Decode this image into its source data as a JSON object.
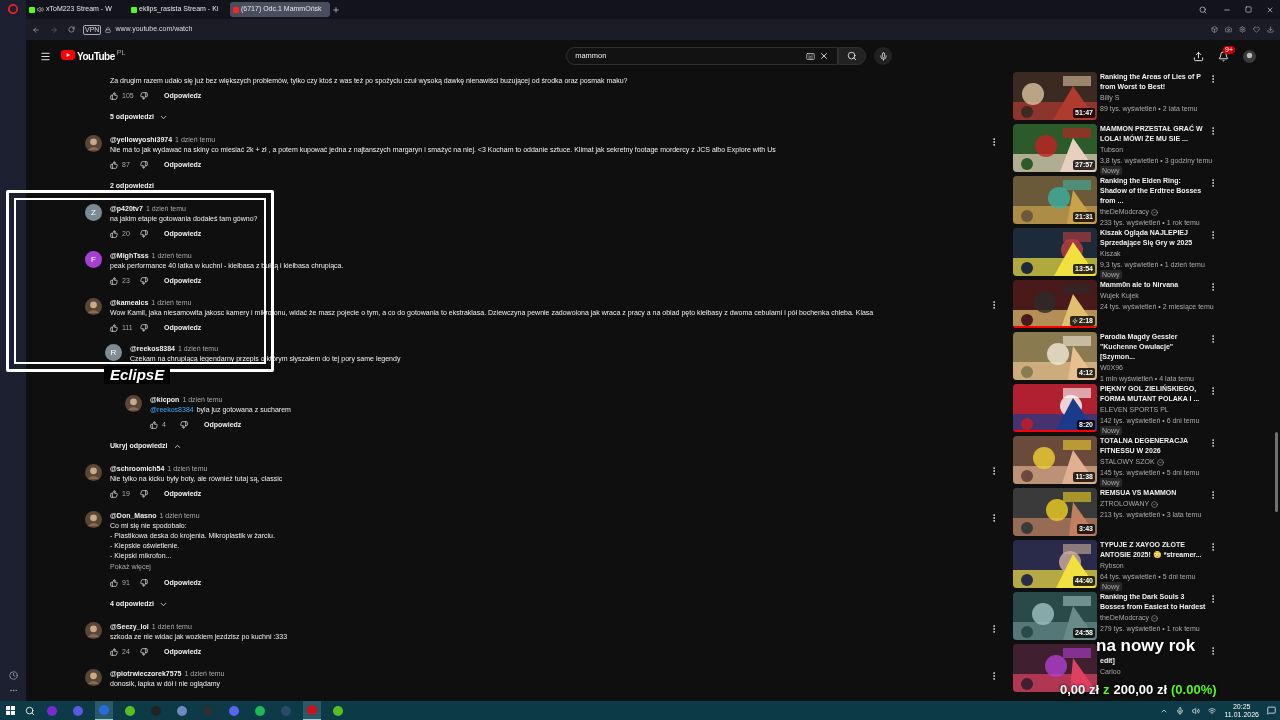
{
  "browser": {
    "tabs": [
      {
        "title": "xToM223 Stream - W",
        "audio": true,
        "selected": false
      },
      {
        "title": "eklips_rasista Stream - Ki",
        "audio": false,
        "selected": false
      },
      {
        "title": "(6717) Odc.1 MammOńsk",
        "audio": false,
        "selected": true
      }
    ],
    "vpn": "VPN",
    "url": "www.youtube.com/watch"
  },
  "youtube": {
    "logo": "YouTube",
    "region": "PL",
    "search": {
      "value": "mammon"
    },
    "notifications": "9+"
  },
  "comments": [
    {
      "body": [
        "Za drugim razem udało się już bez większych problemów, tylko czy ktoś z was też po spożyciu czuł wysoką dawkę nienawiści buzującej od środka oraz posmak maku?"
      ],
      "likes": "105",
      "reply": "Odpowiedz",
      "menu": false,
      "toggle": {
        "label": "5 odpowiedzi",
        "expanded": false
      }
    },
    {
      "author": "@yellowyoshi3974",
      "time": "1 dzień temu",
      "body": [
        "Nie ma to jak wydawać na skiny co miesiać 2k + zł , a potem kupować jedna z najtanszych margaryn i smażyć na niej. <3 Kocham to oddanie sztuce. Klimat jak sekretny footage mordercy z JCS albo Explore with Us"
      ],
      "likes": "87",
      "reply": "Odpowiedz",
      "menu": true,
      "toggle": {
        "label": "2 odpowiedzi"
      }
    },
    {
      "author": "@p420tv7",
      "time": "1 dzień temu",
      "avatar": {
        "letter": "Z",
        "color": "#7b8b95"
      },
      "body": [
        "na jakim etapie gotowania dodałeś tam gówno?"
      ],
      "likes": "20",
      "reply": "Odpowiedz",
      "menu": false
    },
    {
      "author": "@MighTsss",
      "time": "1 dzień temu",
      "avatar": {
        "letter": "F",
        "color": "#a43fd0"
      },
      "body": [
        "peak performance 40 latka w kuchni - kiełbasa z bułką i kiełbasa chrupiąca."
      ],
      "likes": "23",
      "reply": "Odpowiedz",
      "menu": false
    },
    {
      "author": "@kamealcs",
      "time": "1 dzień temu",
      "body": [
        "Wow Kamil, jaka niesamowita jakosc kamery i mikrofonu, widać że masz pojecie o tym, a co do gotowania to ekstraklasa. Dziewczyna pewnie zadowolona jak wraca z pracy a na obiad pęto kiełbasy z dwoma cebulami i pół bochenka chleba. Klasa"
      ],
      "likes": "111",
      "reply": "Odpowiedz",
      "menu": true,
      "children": [
        {
          "author": "@reekos8384",
          "time": "1 dzień temu",
          "avatar": {
            "letter": "R",
            "color": "#7e8c96"
          },
          "body": [
            "Czekam na chrupiącą legendarny przepis o którym słyszałem do tej pory same legendy"
          ],
          "children": [
            {
              "author": "@kicpon",
              "time": "1 dzień temu",
              "mention": "@reekos8384",
              "body": [
                "byla juz gotowana z sucharem"
              ],
              "likes": "4",
              "reply": "Odpowiedz"
            }
          ]
        }
      ],
      "toggle": {
        "label": "Ukryj odpowiedzi",
        "expanded": true
      }
    },
    {
      "author": "@schroomich54",
      "time": "1 dzień temu",
      "body": [
        "Nie tylko na kicku były boty, ale również tutaj są, classic"
      ],
      "likes": "19",
      "reply": "Odpowiedz",
      "menu": true
    },
    {
      "author": "@Don_Masno",
      "time": "1 dzień temu",
      "body": [
        "Co mi się nie spodobało:",
        "- Plastikowa deska do krojenia. Mikroplastik w żarciu.",
        "- Kiepskie oświetlenie.",
        "- Kiepski mikrofon..."
      ],
      "more": "Pokaż więcej",
      "likes": "91",
      "reply": "Odpowiedz",
      "menu": true,
      "toggle": {
        "label": "4 odpowiedzi",
        "expanded": false
      }
    },
    {
      "author": "@Seezy_lol",
      "time": "1 dzień temu",
      "body": [
        "szkoda ze nie widac jak wozkiem jezdzisz po kuchni :333"
      ],
      "likes": "24",
      "reply": "Odpowiedz",
      "menu": true
    },
    {
      "author": "@piotrwieczorek7575",
      "time": "1 dzień temu",
      "body": [
        "donosik, łapka w dół i nie oglądamy"
      ],
      "menu": true
    }
  ],
  "videos": [
    {
      "title": "Ranking the Areas of Lies of P from Worst to Best!",
      "channel": "Billy S",
      "verified": false,
      "stats": "89 tys. wyświetleń • 2 lata temu",
      "duration": "51:47"
    },
    {
      "title": "MAMMON PRZESTAŁ GRAĆ W LOLA! MÓWI ŻE MU SIE ...",
      "channel": "Tubson",
      "verified": false,
      "stats": "3,8 tys. wyświetleń • 3 godziny temu",
      "duration": "27:57",
      "badge": "Nowy"
    },
    {
      "title": "Ranking the Elden Ring: Shadow of the Erdtree Bosses from ...",
      "channel": "theDeModcracy",
      "verified": true,
      "stats": "233 tys. wyświetleń • 1 rok temu",
      "duration": "21:31"
    },
    {
      "title": "Kiszak Ogląda NAJLEPIEJ Sprzedające Się Gry w 2025",
      "channel": "Kiszak",
      "verified": false,
      "stats": "9,3 tys. wyświetleń • 1 dzień temu",
      "duration": "13:54",
      "badge": "Nowy"
    },
    {
      "title": "Mamm0n ale to Nirvana",
      "channel": "Wujek Kujek",
      "verified": false,
      "stats": "24 tys. wyświetleń • 2 miesiące temu",
      "duration": "2:18",
      "short": true,
      "level": 1
    },
    {
      "title": "Parodia Magdy Gessler \"Kuchenne Owulacje\" [Szymon...",
      "channel": "W0X96",
      "verified": false,
      "stats": "1 mln wyświetleń • 4 lata temu",
      "duration": "4:12"
    },
    {
      "title": "PIĘKNY GOL ZIELIŃSKIEGO, FORMA MUTANT POLAKA I ...",
      "channel": "ELEVEN SPORTS PL",
      "verified": false,
      "stats": "142 tys. wyświetleń • 6 dni temu",
      "duration": "8:20",
      "badge": "Nowy",
      "level": 1
    },
    {
      "title": "TOTALNA DEGENERACJA FITNESSU W 2026",
      "channel": "STALOWY SZOK",
      "verified": true,
      "stats": "145 tys. wyświetleń • 5 dni temu",
      "duration": "11:38",
      "badge": "Nowy"
    },
    {
      "title": "REMSUA VS MAMMON",
      "channel": "ZTROLOWANY",
      "verified": true,
      "stats": "213 tys. wyświetleń • 3 lata temu",
      "duration": "3:43"
    },
    {
      "title": "TYPUJE Z XAYOO  ZŁOTE ANTOSIE 2025! 😳 *streamer...",
      "channel": "Rybson",
      "verified": false,
      "stats": "64 tys. wyświetleń • 5 dni temu",
      "duration": "44:40",
      "badge": "Nowy"
    },
    {
      "title": "Ranking the Dark Souls 3 Bosses from Easiest to Hardest",
      "channel": "theDeModcracy",
      "verified": true,
      "stats": "279 tys. wyświetleń • 1 rok temu",
      "duration": "24:58"
    },
    {
      "title": "edit]",
      "title_cut": true,
      "channel": "Carloo",
      "verified": false
    }
  ],
  "stream_overlay": {
    "label": "EclipsE"
  },
  "goal_overlay": {
    "title": "na nowy rok",
    "current": "0,00 zł",
    "separator": "z",
    "target": "200,00 zł",
    "percent": "(0.00%)"
  },
  "taskbar": {
    "apps": [
      {
        "selected": false
      },
      {
        "selected": false
      },
      {
        "selected": true
      },
      {
        "selected": false
      },
      {
        "selected": false
      },
      {
        "selected": false
      },
      {
        "selected": false
      },
      {
        "selected": false
      },
      {
        "selected": false
      },
      {
        "selected": false
      },
      {
        "selected": true
      },
      {
        "selected": false
      }
    ],
    "time": "20:25",
    "date": "11.01.2026"
  }
}
